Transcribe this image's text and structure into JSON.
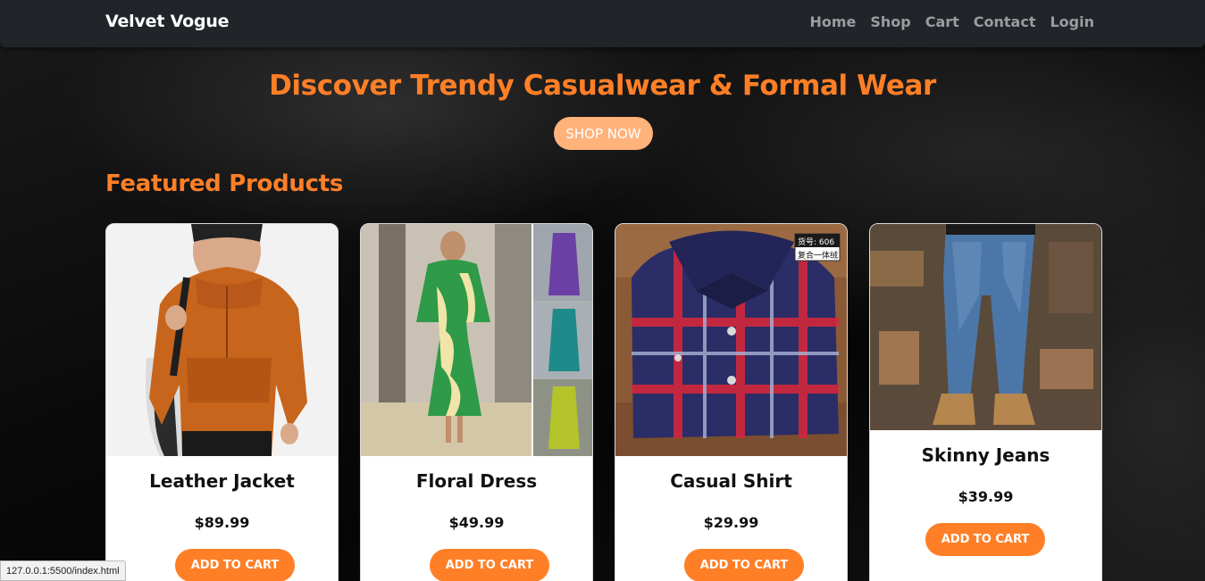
{
  "navbar": {
    "brand": "Velvet Vogue",
    "links": [
      "Home",
      "Shop",
      "Cart",
      "Contact",
      "Login"
    ]
  },
  "hero": {
    "title": "Discover Trendy Casualwear & Formal Wear",
    "cta": "SHOP NOW"
  },
  "featured": {
    "title": "Featured Products",
    "products": [
      {
        "name": "Leather Jacket",
        "price": "$89.99",
        "button": "ADD TO CART"
      },
      {
        "name": "Floral Dress",
        "price": "$49.99",
        "button": "ADD TO CART"
      },
      {
        "name": "Casual Shirt",
        "price": "$29.99",
        "button": "ADD TO CART"
      },
      {
        "name": "Skinny Jeans",
        "price": "$39.99",
        "button": "ADD TO CART"
      }
    ],
    "shirt_tag": [
      "货号: 606",
      "复合一体绒"
    ]
  },
  "status_url": "127.0.0.1:5500/index.html",
  "colors": {
    "accent": "#ff7f27",
    "cta_light": "#ffb27a",
    "navbar": "#212529"
  }
}
